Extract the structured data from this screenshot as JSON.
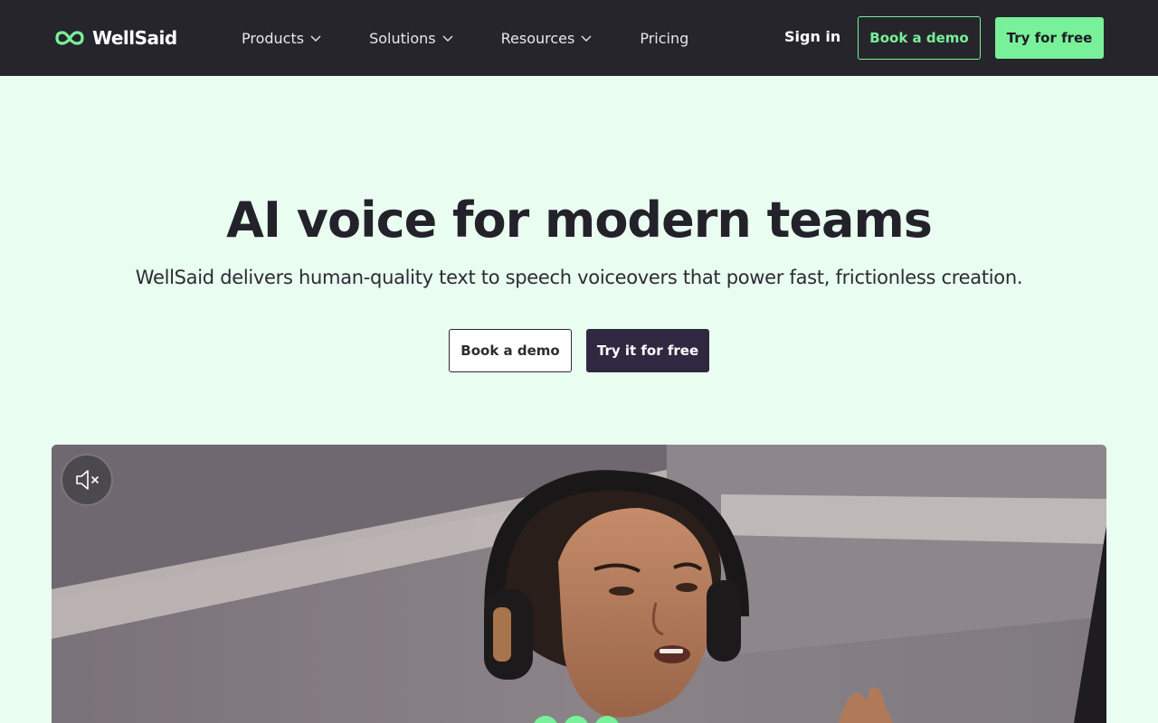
{
  "brand": {
    "name": "WellSaid",
    "accent": "#79f09a",
    "dark": "#26252b",
    "hero_bg": "#e9fdf0"
  },
  "nav": {
    "items": [
      {
        "label": "Products",
        "has_dropdown": true
      },
      {
        "label": "Solutions",
        "has_dropdown": true
      },
      {
        "label": "Resources",
        "has_dropdown": true
      },
      {
        "label": "Pricing",
        "has_dropdown": false
      }
    ],
    "sign_in": "Sign in",
    "book_demo": "Book a demo",
    "try_free": "Try for free"
  },
  "hero": {
    "title": "AI voice for modern teams",
    "subtitle": "WellSaid delivers human-quality text to speech voiceovers that power fast, frictionless creation.",
    "book_demo": "Book a demo",
    "try_free": "Try it for free"
  },
  "video": {
    "mute_icon": "speaker-muted-icon",
    "muted": true
  }
}
